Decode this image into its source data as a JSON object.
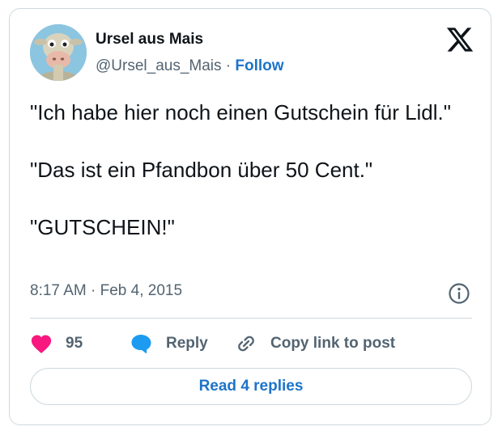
{
  "author": {
    "name": "Ursel aus Mais",
    "handle": "@Ursel_aus_Mais",
    "separator": "·",
    "follow_label": "Follow"
  },
  "tweet": {
    "paragraphs": [
      "\"Ich habe hier noch einen Gutschein für Lidl.\"",
      "\"Das ist ein Pfandbon über 50 Cent.\"",
      "\"GUTSCHEIN!\""
    ],
    "time": "8:17 AM",
    "separator": "·",
    "date": "Feb 4, 2015"
  },
  "actions": {
    "likes_count": "95",
    "reply_label": "Reply",
    "copy_label": "Copy link to post"
  },
  "read_replies_label": "Read 4 replies",
  "colors": {
    "accent": "#1d74c9",
    "like": "#f91880",
    "reply_icon": "#1d9bf0",
    "muted": "#536471",
    "border": "#cfd9de"
  },
  "icons": [
    "avatar-cow",
    "x-logo-icon",
    "info-icon",
    "heart-icon",
    "reply-bubble-icon",
    "link-icon"
  ]
}
